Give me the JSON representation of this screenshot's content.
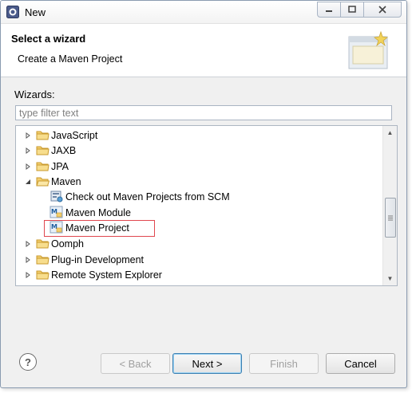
{
  "window": {
    "title": "New"
  },
  "banner": {
    "title": "Select a wizard",
    "description": "Create a Maven Project"
  },
  "wizards": {
    "label": "Wizards:",
    "filter_placeholder": "type filter text"
  },
  "tree": {
    "items": [
      {
        "label": "JavaScript",
        "kind": "folder",
        "expanded": false
      },
      {
        "label": "JAXB",
        "kind": "folder",
        "expanded": false
      },
      {
        "label": "JPA",
        "kind": "folder",
        "expanded": false
      },
      {
        "label": "Maven",
        "kind": "folder",
        "expanded": true
      },
      {
        "label": "Check out Maven Projects from SCM",
        "kind": "scm-icon"
      },
      {
        "label": "Maven Module",
        "kind": "maven-icon"
      },
      {
        "label": "Maven Project",
        "kind": "maven-icon",
        "selected": true
      },
      {
        "label": "Oomph",
        "kind": "folder",
        "expanded": false
      },
      {
        "label": "Plug-in Development",
        "kind": "folder",
        "expanded": false
      },
      {
        "label": "Remote System Explorer",
        "kind": "folder",
        "expanded": false
      }
    ]
  },
  "buttons": {
    "back": "< Back",
    "next": "Next >",
    "finish": "Finish",
    "cancel": "Cancel",
    "help": "?"
  },
  "colors": {
    "selection_border": "#e0474f",
    "folder": "#e8b84a"
  }
}
